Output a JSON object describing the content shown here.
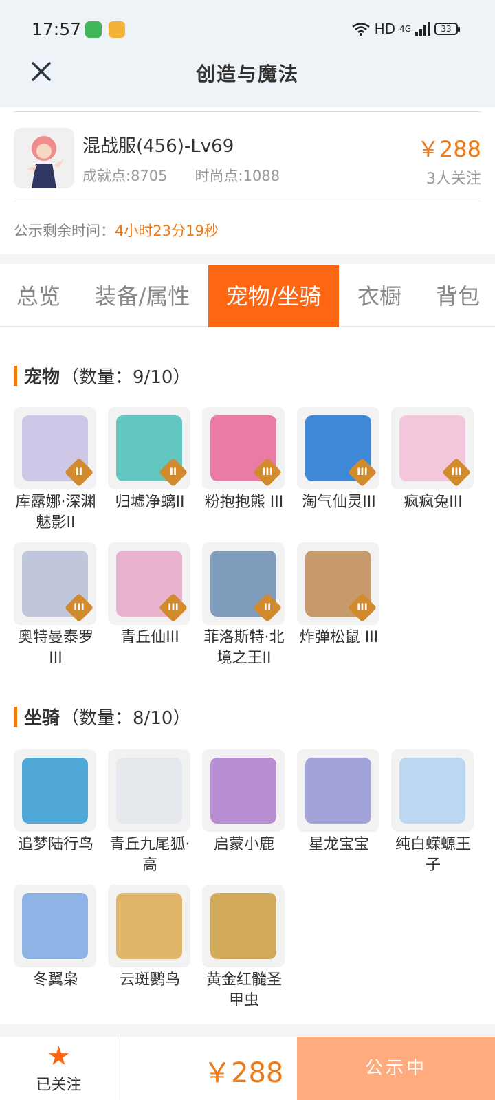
{
  "status_bar": {
    "time": "17:57",
    "network": "HD",
    "signal": "4G",
    "battery": "33"
  },
  "titlebar": {
    "title": "创造与魔法"
  },
  "product": {
    "name": "混战服(456)-Lv69",
    "achievement": "成就点:8705",
    "fashion": "时尚点:1088",
    "price": "￥288",
    "followers": "3人关注"
  },
  "announce": {
    "label": "公示剩余时间：",
    "time": "4小时23分19秒"
  },
  "tabs": [
    {
      "label": "总览"
    },
    {
      "label": "装备/属性"
    },
    {
      "label": "宠物/坐骑"
    },
    {
      "label": "衣橱"
    },
    {
      "label": "背包"
    }
  ],
  "pets": {
    "title": "宠物",
    "count": "（数量：9/10）",
    "items": [
      {
        "name": "库露娜·深渊魅影II",
        "rank": "II",
        "color": "#cfc7e8"
      },
      {
        "name": "归墟净螭II",
        "rank": "II",
        "color": "#63c6c0"
      },
      {
        "name": "粉抱抱熊 III",
        "rank": "III",
        "color": "#ea7aa6"
      },
      {
        "name": "淘气仙灵III",
        "rank": "III",
        "color": "#3f88d8"
      },
      {
        "name": "疯疯兔III",
        "rank": "III",
        "color": "#f3c7dc"
      },
      {
        "name": "奥特曼泰罗III",
        "rank": "III",
        "color": "#c0c7dc"
      },
      {
        "name": "青丘仙III",
        "rank": "III",
        "color": "#e9b3cf"
      },
      {
        "name": "菲洛斯特·北境之王II",
        "rank": "II",
        "color": "#7f9cbd"
      },
      {
        "name": "炸弹松鼠 III",
        "rank": "III",
        "color": "#c79a6b"
      }
    ]
  },
  "mounts": {
    "title": "坐骑",
    "count": "（数量：8/10）",
    "items": [
      {
        "name": "追梦陆行鸟",
        "color": "#4fa8d8"
      },
      {
        "name": "青丘九尾狐·高",
        "color": "#e5e9ee"
      },
      {
        "name": "启蒙小鹿",
        "color": "#b98fd3"
      },
      {
        "name": "星龙宝宝",
        "color": "#a2a3d8"
      },
      {
        "name": "纯白蝾螈王子",
        "color": "#bcd7f0"
      },
      {
        "name": "冬翼枭",
        "color": "#8fb3e5"
      },
      {
        "name": "云斑鹦鸟",
        "color": "#e0b66a"
      },
      {
        "name": "黄金红髓圣甲虫",
        "color": "#d1aa5a"
      }
    ]
  },
  "bottombar": {
    "follow_label": "已关注",
    "price": "￥288",
    "status": "公示中"
  }
}
